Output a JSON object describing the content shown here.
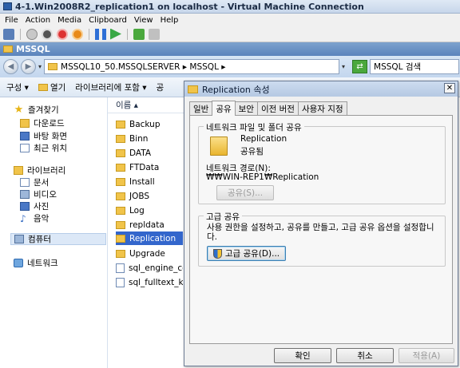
{
  "vm": {
    "title": "4-1.Win2008R2_replication1 on localhost - Virtual Machine Connection",
    "menu": [
      "File",
      "Action",
      "Media",
      "Clipboard",
      "View",
      "Help"
    ]
  },
  "explorer": {
    "title": "MSSQL",
    "address": "MSSQL10_50.MSSQLSERVER  ▸  MSSQL  ▸",
    "search_placeholder": "MSSQL 검색",
    "commands": {
      "organize": "구성 ▾",
      "open": "열기",
      "include_library": "라이브러리에 포함  ▾",
      "more": "공"
    },
    "nav": {
      "favorites": "즐겨찾기",
      "downloads": "다운로드",
      "desktop": "바탕 화면",
      "recent": "최근 위치",
      "libraries": "라이브러리",
      "documents": "문서",
      "videos": "비디오",
      "pictures": "사진",
      "music": "음악",
      "computer": "컴퓨터",
      "network": "네트워크"
    },
    "column_name": "이름 ▴",
    "files": [
      "Backup",
      "Binn",
      "DATA",
      "FTData",
      "Install",
      "JOBS",
      "Log",
      "repldata",
      "Replication",
      "Upgrade",
      "sql_engine_co",
      "sql_fulltext_key"
    ],
    "selected_file": "Replication"
  },
  "dialog": {
    "title": "Replication 속성",
    "close": "✕",
    "tabs": [
      "일반",
      "공유",
      "보안",
      "이전 버전",
      "사용자 지정"
    ],
    "active_tab": "공유",
    "network_sharing": {
      "group_label": "네트워크 파일 및 폴더 공유",
      "folder_name": "Replication",
      "status": "공유됨",
      "path_label": "네트워크 경로(N):",
      "path_value": "₩₩WIN-REP1₩Replication",
      "share_button": "공유(S)..."
    },
    "advanced_sharing": {
      "group_label": "고급 공유",
      "description_line1": "사용 권한을 설정하고, 공유를 만들고, 고급 공유 옵션을 설정합니",
      "description_line2": "다.",
      "button": "고급 공유(D)..."
    },
    "buttons": {
      "ok": "확인",
      "cancel": "취소",
      "apply": "적용(A)"
    }
  }
}
